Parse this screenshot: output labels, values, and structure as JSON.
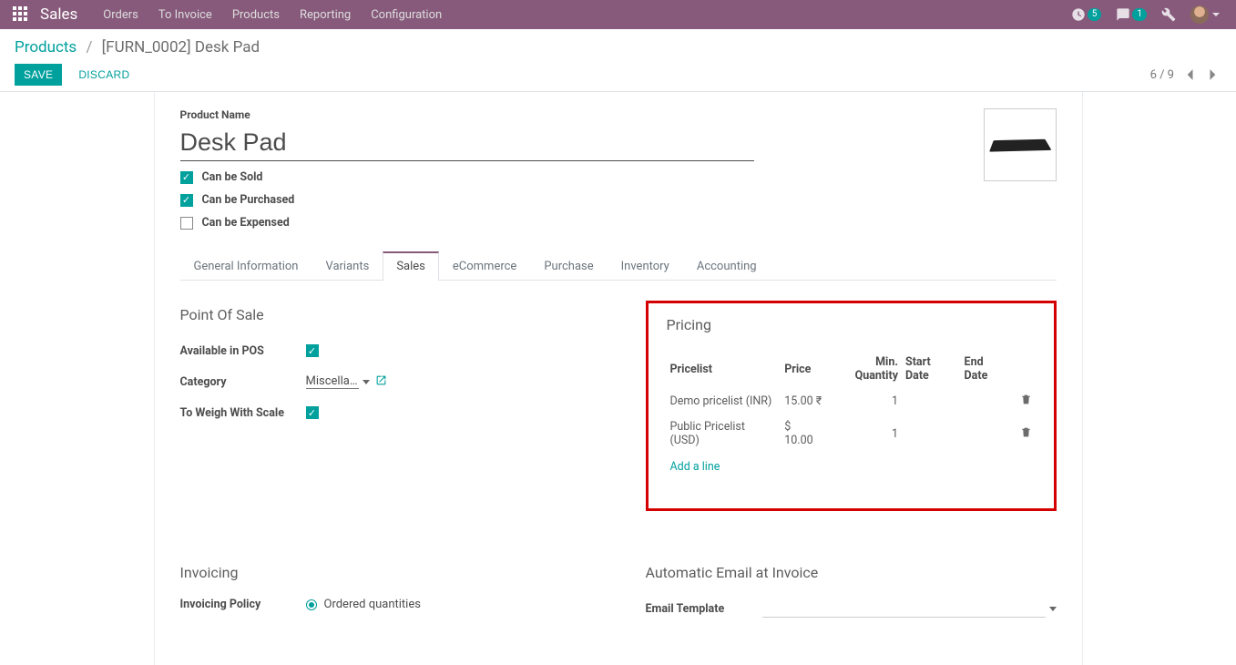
{
  "topbar": {
    "app": "Sales",
    "nav": [
      "Orders",
      "To Invoice",
      "Products",
      "Reporting",
      "Configuration"
    ],
    "badge_activity": "5",
    "badge_discuss": "1"
  },
  "breadcrumb": {
    "root": "Products",
    "current": "[FURN_0002] Desk Pad"
  },
  "actions": {
    "save": "SAVE",
    "discard": "DISCARD"
  },
  "pager": {
    "text": "6 / 9"
  },
  "form": {
    "name_label": "Product Name",
    "name": "Desk Pad",
    "can_sold": "Can be Sold",
    "can_purchased": "Can be Purchased",
    "can_expensed": "Can be Expensed"
  },
  "tabs": [
    "General Information",
    "Variants",
    "Sales",
    "eCommerce",
    "Purchase",
    "Inventory",
    "Accounting"
  ],
  "pos": {
    "heading": "Point Of Sale",
    "available_label": "Available in POS",
    "category_label": "Category",
    "category_value": "Miscellaneous",
    "weigh_label": "To Weigh With Scale"
  },
  "pricing": {
    "heading": "Pricing",
    "cols": {
      "pricelist": "Pricelist",
      "price": "Price",
      "minqty": "Min. Quantity",
      "start": "Start Date",
      "end": "End Date"
    },
    "rows": [
      {
        "pricelist": "Demo pricelist (INR)",
        "price": "15.00 ₹",
        "minqty": "1",
        "start": "",
        "end": ""
      },
      {
        "pricelist": "Public Pricelist (USD)",
        "price": "$ 10.00",
        "minqty": "1",
        "start": "",
        "end": ""
      }
    ],
    "add": "Add a line"
  },
  "invoicing": {
    "heading": "Invoicing",
    "policy_label": "Invoicing Policy",
    "policy_ordered": "Ordered quantities"
  },
  "auto_email": {
    "heading": "Automatic Email at Invoice",
    "template_label": "Email Template"
  }
}
